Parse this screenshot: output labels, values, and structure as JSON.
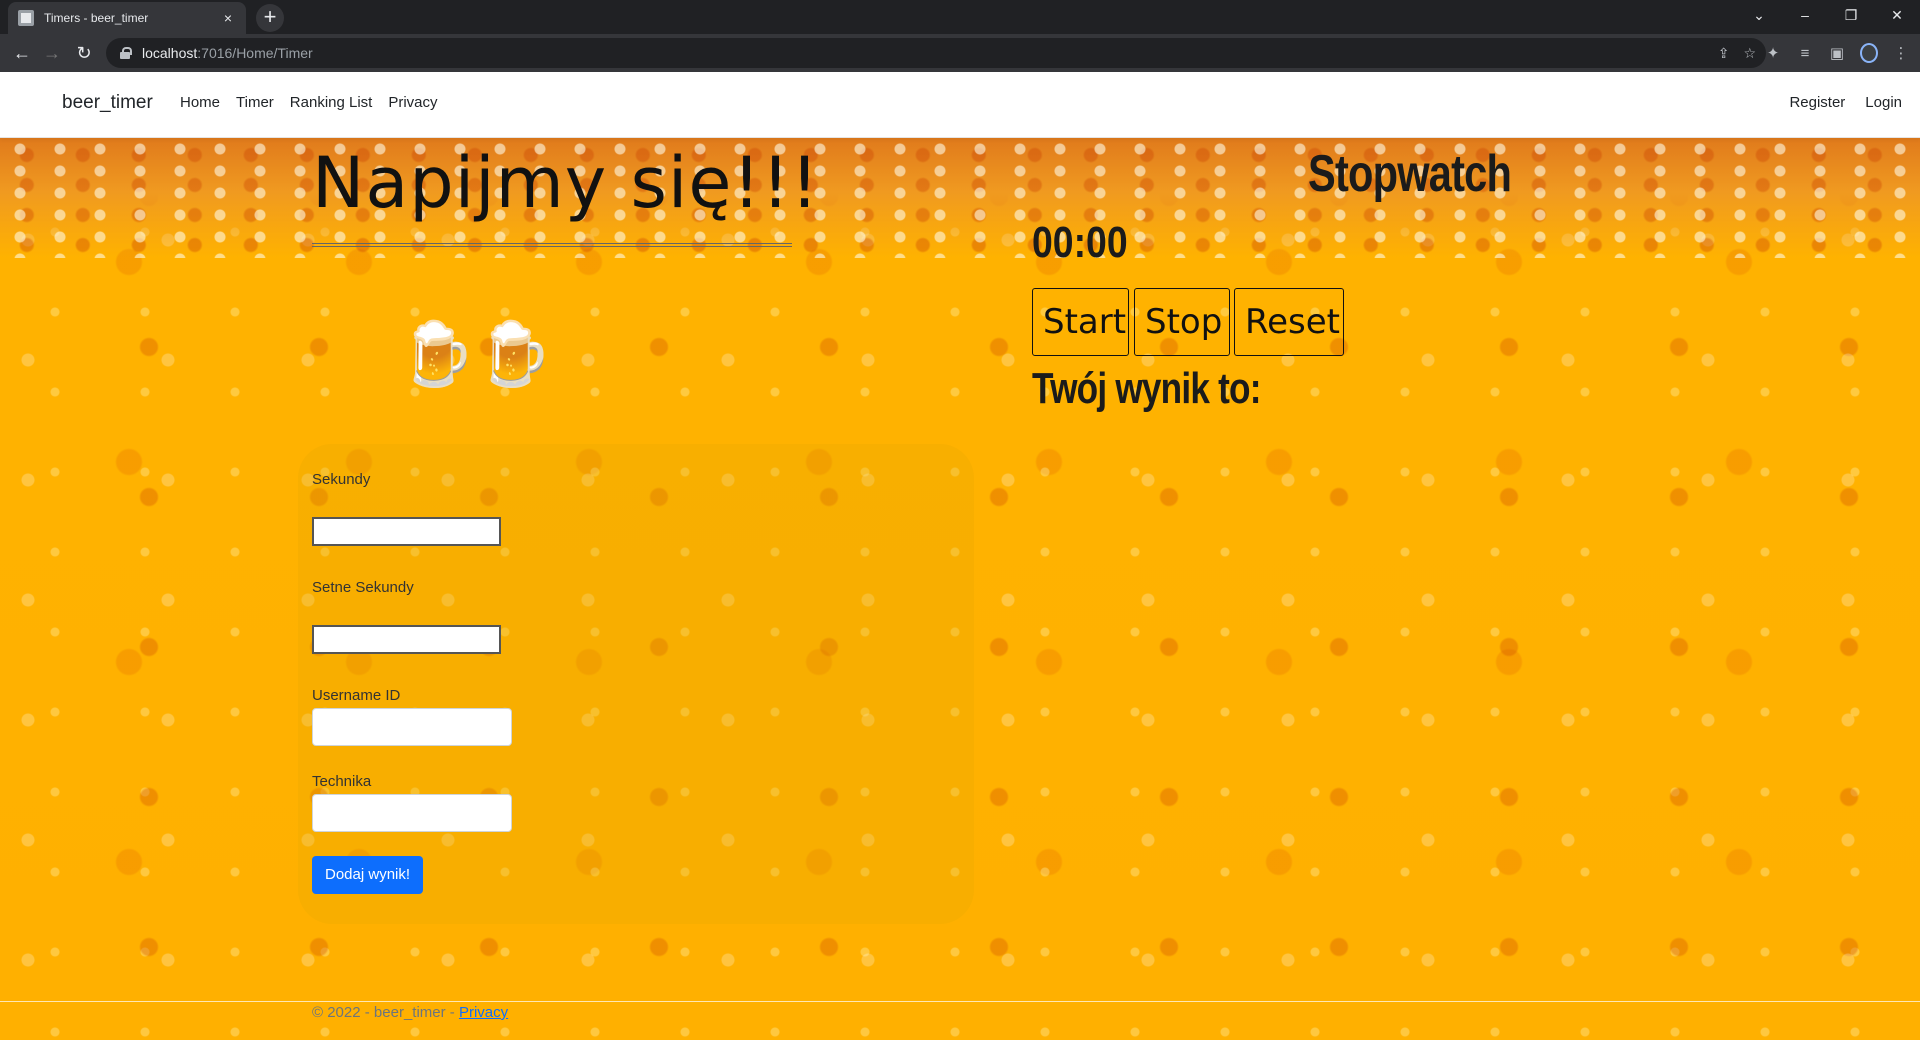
{
  "browser": {
    "tab_title": "Timers - beer_timer",
    "tab_close": "×",
    "new_tab": "+",
    "url_host": "localhost",
    "url_path": ":7016/Home/Timer",
    "window_controls": [
      "⌄",
      "–",
      "❐",
      "✕"
    ]
  },
  "navbar": {
    "brand": "beer_timer",
    "links": [
      "Home",
      "Timer",
      "Ranking List",
      "Privacy"
    ],
    "register": "Register",
    "login": "Login"
  },
  "main": {
    "title": "Napijmy się!!!",
    "beer_icon": "🍺🍺"
  },
  "form": {
    "seconds_label": "Sekundy",
    "hundredths_label": "Setne Sekundy",
    "username_label": "Username ID",
    "technique_label": "Technika",
    "submit_label": "Dodaj wynik!"
  },
  "stopwatch": {
    "title": "Stopwatch",
    "time": "00:00",
    "start_label": "Start",
    "stop_label": "Stop",
    "reset_label": "Reset",
    "result_label": "Twój wynik to:"
  },
  "footer": {
    "text": "© 2022 - beer_timer - ",
    "privacy_link": "Privacy"
  },
  "colors": {
    "beer_background": "#ffb000",
    "primary_button": "#0d6efd"
  }
}
